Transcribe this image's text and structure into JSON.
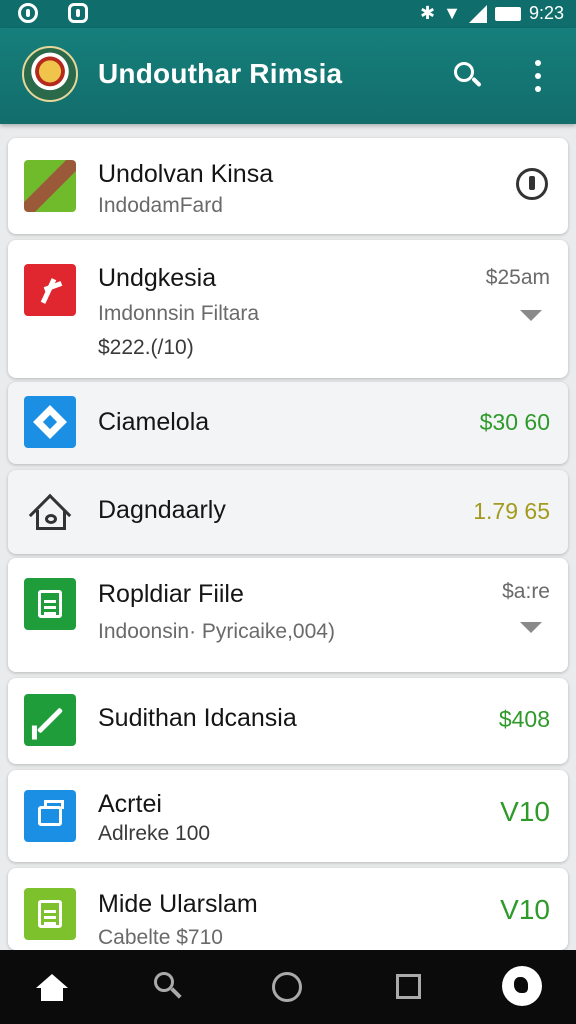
{
  "status_bar": {
    "time": "9:23"
  },
  "app_bar": {
    "title": "Undouthar Rimsia",
    "search_icon": "search-icon",
    "more_icon": "more-vertical-icon"
  },
  "colors": {
    "app_bar": "#167f7b",
    "positive_amount": "#2e9a2a",
    "neutral_amount": "#a39b1d",
    "nav_bar": "#0b0b0b"
  },
  "items": [
    {
      "title": "Undolvan Kinsa",
      "subtitle": "IndodamFard",
      "trailing": "info-icon"
    },
    {
      "title": "Undgkesia",
      "subtitle": "Imdonnsin Filtara",
      "subtitle2": "$222.(/10)",
      "amount": "$25am"
    },
    {
      "title": "Ciamelola",
      "amount": "$30 60"
    },
    {
      "title": "Dagndaarly",
      "amount": "1.79 65"
    },
    {
      "title": "Ropldiar Fiile",
      "subtitle": "Indoonsin· Pyricaike,004)",
      "amount": "$a:re"
    },
    {
      "title": "Sudithan Idcansia",
      "amount": "$408"
    },
    {
      "title": "Acrtei",
      "subtitle": "Adlreke 100",
      "amount": "V10"
    },
    {
      "title": "Mide Ularslam",
      "subtitle": "Cabelte $710",
      "amount": "V10"
    }
  ],
  "nav": {
    "icons": [
      "home-icon",
      "search-icon",
      "circle-home-icon",
      "square-recents-icon",
      "profile-icon"
    ]
  }
}
